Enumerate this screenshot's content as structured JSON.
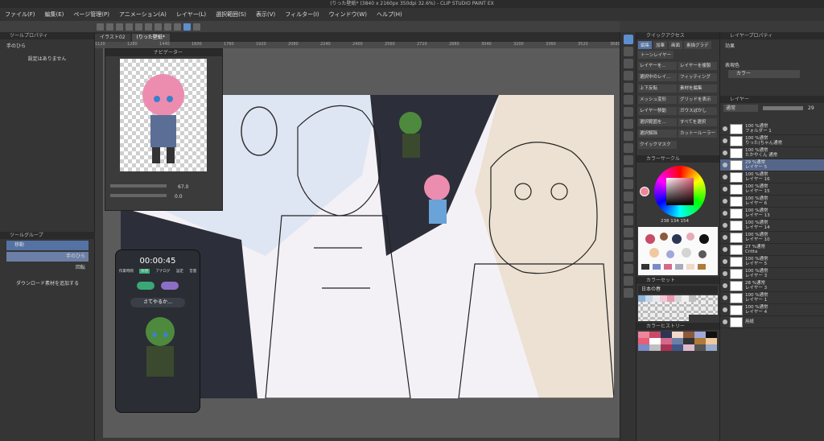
{
  "title": "(りった壁紙* (3840 x 2160px 350dpi 32.6%) - CLIP STUDIO PAINT EX",
  "menu": [
    "ファイル(F)",
    "編集(E)",
    "ページ管理(P)",
    "アニメーション(A)",
    "レイヤー(L)",
    "選択範囲(S)",
    "表示(V)",
    "フィルター(I)",
    "ウィンドウ(W)",
    "ヘルプ(H)"
  ],
  "doc_tabs": [
    "イラスト02",
    "(りった壁紙*"
  ],
  "ruler_ticks": [
    "1120",
    "1280",
    "1440",
    "1600",
    "1760",
    "1920",
    "2080",
    "2240",
    "2400",
    "2560",
    "2720",
    "2880",
    "3040",
    "3200",
    "3360",
    "3520",
    "3680"
  ],
  "tool_property": {
    "header": "ツールプロパティ",
    "subheader": "手のひら",
    "empty": "設定はありません"
  },
  "navigator": {
    "header": "ナビゲーター",
    "zoom": "67.0",
    "angle": "0.0"
  },
  "subtool": {
    "header": "ツールグループ",
    "items": [
      "移動",
      "手のひら",
      "回転"
    ],
    "download": "ダウンロード素材を追加する"
  },
  "timer": {
    "time": "00:00:45",
    "tabs": [
      "作業時間",
      "休憩",
      "アナログ",
      "設定",
      "音量"
    ],
    "message": "さてやるか…"
  },
  "quick_access": {
    "header": "クイックアクセス",
    "tabs": [
      "編集",
      "加筆",
      "画面",
      "素描グラデ",
      "トーンレイヤー"
    ],
    "buttons": [
      "レイヤーを...",
      "レイヤーを複製",
      "選択中のレイ...",
      "フィッティング",
      "上下反転",
      "素材を編集",
      "メッシュ変形",
      "グリッドを表示",
      "レイヤー移動",
      "ガウスぼかし",
      "選択範囲を...",
      "すべてを選択",
      "選択解除",
      "カットールーラー",
      "クイックマスク"
    ]
  },
  "color_wheel": {
    "header": "カラーサークル",
    "values": "238 134 154"
  },
  "color_set": {
    "header": "カラーセット",
    "name": "日本の春"
  },
  "history_header": "カラーヒストリー",
  "layer_panel": {
    "header": "レイヤー",
    "blend": "通常",
    "opacity": "29",
    "prop_header": "レイヤープロパティ",
    "effect_label": "効果",
    "expression_label": "表現色",
    "expression_value": "カラー",
    "layers": [
      {
        "pct": "100 %通常",
        "name": "フォルダー 1",
        "sel": false
      },
      {
        "pct": "100 %通常",
        "name": "りった(ちゃん通常",
        "sel": false
      },
      {
        "pct": "100 %通常",
        "name": "たかやくん 通常",
        "sel": false
      },
      {
        "pct": "29 %通常",
        "name": "レイヤー 5",
        "sel": true
      },
      {
        "pct": "100 %通常",
        "name": "レイヤー 16",
        "sel": false
      },
      {
        "pct": "100 %通常",
        "name": "レイヤー 15",
        "sel": false
      },
      {
        "pct": "100 %通常",
        "name": "レイヤー 6",
        "sel": false
      },
      {
        "pct": "100 %通常",
        "name": "レイヤー 13",
        "sel": false
      },
      {
        "pct": "100 %通常",
        "name": "レイヤー 14",
        "sel": false
      },
      {
        "pct": "100 %通常",
        "name": "レイヤー 10",
        "sel": false
      },
      {
        "pct": "27 %通常",
        "name": "Critta",
        "sel": false
      },
      {
        "pct": "100 %通常",
        "name": "レイヤー 5",
        "sel": false
      },
      {
        "pct": "100 %通常",
        "name": "レイヤー 3",
        "sel": false
      },
      {
        "pct": "28 %通常",
        "name": "レイヤー 3",
        "sel": false
      },
      {
        "pct": "100 %通常",
        "name": "レイヤー 1",
        "sel": false
      },
      {
        "pct": "100 %通常",
        "name": "レイヤー 4",
        "sel": false
      },
      {
        "pct": "",
        "name": "用紙",
        "sel": false
      }
    ]
  },
  "colors": {
    "accent": "#5d8fd0",
    "selected_layer": "#55668a",
    "current_color": "#ee869a"
  }
}
